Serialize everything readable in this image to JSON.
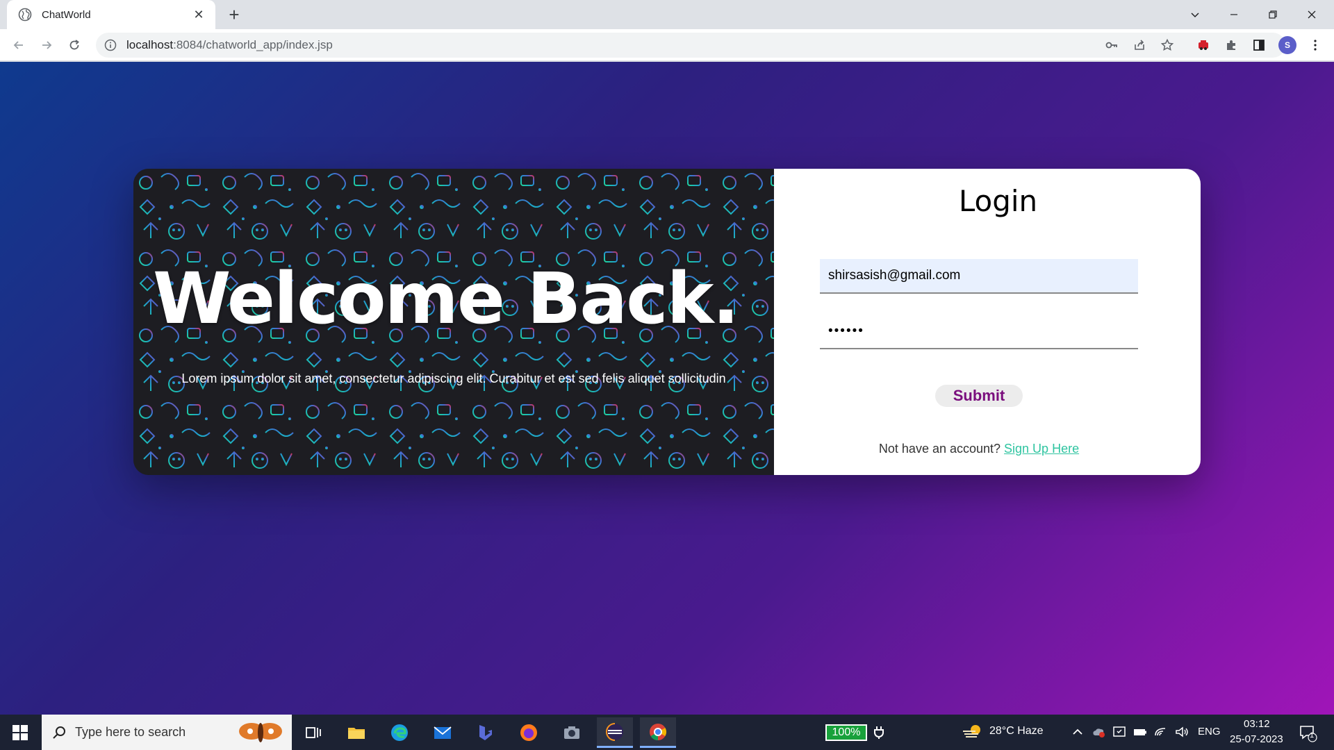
{
  "browser": {
    "tab_title": "ChatWorld",
    "url_host": "localhost",
    "url_path": ":8084/chatworld_app/index.jsp",
    "profile_initial": "S"
  },
  "hero": {
    "heading": "Welcome Back.",
    "subtext": "Lorem ipsum dolor sit amet, consectetur adipiscing elit. Curabitur et est sed felis aliquet sollicitudin"
  },
  "login": {
    "title": "Login",
    "email_value": "shirsasish@gmail.com",
    "password_value": "••••••",
    "submit_label": "Submit",
    "signup_prompt": "Not have an account? ",
    "signup_link": "Sign Up Here"
  },
  "taskbar": {
    "search_placeholder": "Type here to search",
    "battery": "100%",
    "weather": "28°C  Haze",
    "lang": "ENG",
    "time": "03:12",
    "date": "25-07-2023",
    "notification_count": "1"
  },
  "colors": {
    "submit_text": "#7a0e7d",
    "signup_link": "#2ec4a0",
    "email_bg": "#e8f0fe"
  }
}
